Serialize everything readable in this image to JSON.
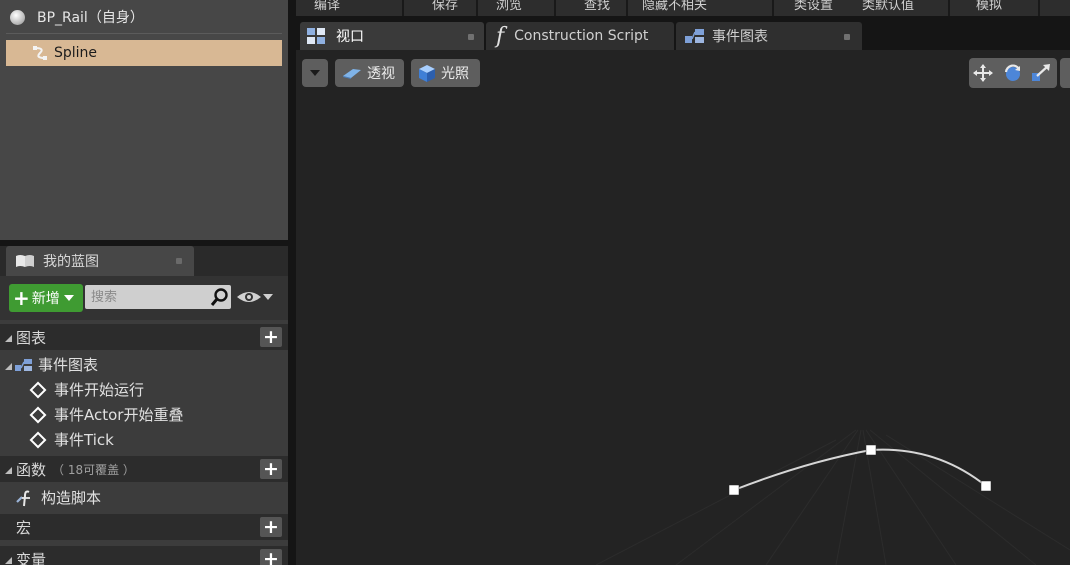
{
  "components": {
    "root_label": "BP_Rail（自身）",
    "spline_label": "Spline"
  },
  "my_blueprint": {
    "tab_title": "我的蓝图",
    "add_label": "新增",
    "search_placeholder": "搜索",
    "categories": {
      "graphs": "图表",
      "event_graph": "事件图表",
      "events": [
        "事件开始运行",
        "事件Actor开始重叠",
        "事件Tick"
      ],
      "functions": "函数",
      "functions_hint": "（ 18可覆盖 ）",
      "construction_script": "构造脚本",
      "macros": "宏",
      "variables": "变量"
    }
  },
  "toolbar_top": {
    "buttons": [
      "编译",
      "保存",
      "浏览",
      "查找",
      "隐藏不相关",
      "类设置",
      "类默认值",
      "模拟"
    ]
  },
  "document_tabs": [
    {
      "label": "视口",
      "active": true,
      "icon": "viewport-icon"
    },
    {
      "label": "Construction Script",
      "active": false,
      "icon": "function-icon"
    },
    {
      "label": "事件图表",
      "active": false,
      "icon": "event-graph-icon"
    }
  ],
  "viewport": {
    "perspective_label": "透视",
    "lit_label": "光照",
    "spline_points": 3
  },
  "colors": {
    "selection": "#d8b894",
    "add_button": "#3f9b32",
    "panel_bg": "#3c3c3c",
    "viewport_bg": "#232323"
  }
}
